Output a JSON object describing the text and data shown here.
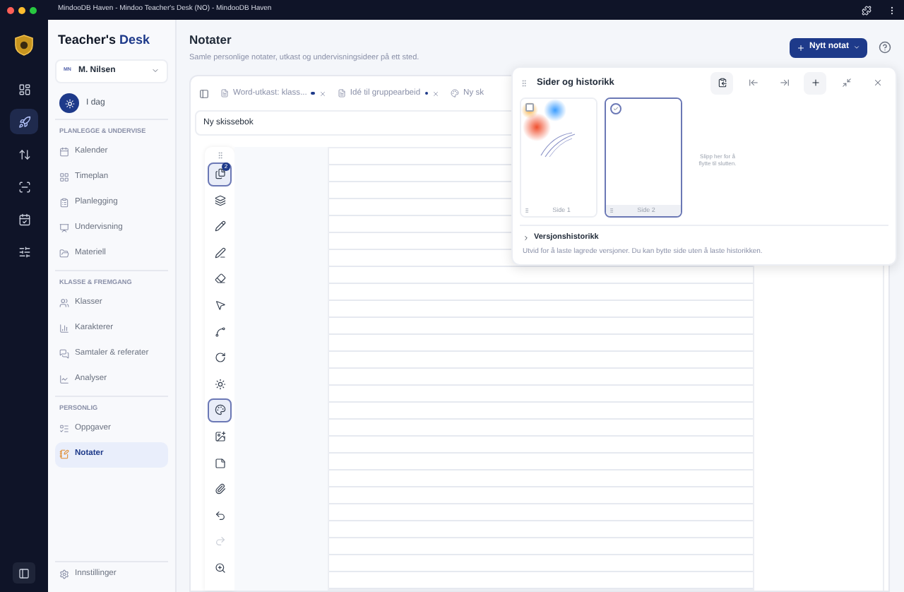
{
  "window": {
    "title": "MindooDB Haven - Mindoo Teacher's Desk (NO) - MindooDB Haven"
  },
  "rail": {
    "items": [
      {
        "kind": "dashboard",
        "selected": false
      },
      {
        "kind": "rocket",
        "selected": true
      },
      {
        "kind": "sort",
        "selected": false
      },
      {
        "kind": "scan",
        "selected": false
      },
      {
        "kind": "calendar",
        "selected": false
      },
      {
        "kind": "sliders",
        "selected": false
      }
    ]
  },
  "sidebar": {
    "brand": {
      "first": "Teacher's",
      "second": "Desk"
    },
    "user": {
      "initials": "MN",
      "name": "M. Nilsen"
    },
    "today": {
      "label": "I dag"
    },
    "sections": [
      {
        "heading": "PLANLEGGE & UNDERVISE",
        "items": [
          {
            "kind": "calendar",
            "label": "Kalender",
            "selected": false
          },
          {
            "kind": "grid",
            "label": "Timeplan",
            "selected": false
          },
          {
            "kind": "clipboard",
            "label": "Planlegging",
            "selected": false
          },
          {
            "kind": "presentation",
            "label": "Undervisning",
            "selected": false
          },
          {
            "kind": "folder",
            "label": "Materiell",
            "selected": false
          }
        ]
      },
      {
        "heading": "KLASSE & FREMGANG",
        "items": [
          {
            "kind": "users",
            "label": "Klasser",
            "selected": false
          },
          {
            "kind": "bars",
            "label": "Karakterer",
            "selected": false
          },
          {
            "kind": "chat",
            "label": "Samtaler & referater",
            "selected": false
          },
          {
            "kind": "chart",
            "label": "Analyser",
            "selected": false
          }
        ]
      },
      {
        "heading": "PERSONLIG",
        "items": [
          {
            "kind": "tasks",
            "label": "Oppgaver",
            "selected": false
          },
          {
            "kind": "notes",
            "label": "Notater",
            "selected": true
          }
        ]
      }
    ],
    "settings": "Innstillinger"
  },
  "header": {
    "title": "Notater",
    "subtitle": "Samle personlige notater, utkast og undervisningsideer på ett sted.",
    "new_button": "Nytt notat"
  },
  "tabs": [
    {
      "kind": "doc",
      "label": "Word-utkast: klass...",
      "unsaved": true
    },
    {
      "kind": "doc",
      "label": "Idé til gruppearbeid",
      "unsaved": true
    },
    {
      "kind": "sketch",
      "label": "Ny sk",
      "unsaved": false
    }
  ],
  "title_field": {
    "value": "Ny skissebok"
  },
  "tools": [
    {
      "kind": "pages",
      "selected": true,
      "disabled": false,
      "badge": "2"
    },
    {
      "kind": "layers",
      "selected": false,
      "disabled": false
    },
    {
      "kind": "pencil",
      "selected": false,
      "disabled": false
    },
    {
      "kind": "pen",
      "selected": false,
      "disabled": false
    },
    {
      "kind": "eraser",
      "selected": false,
      "disabled": false
    },
    {
      "kind": "select",
      "selected": false,
      "disabled": false
    },
    {
      "kind": "curve",
      "selected": false,
      "disabled": false
    },
    {
      "kind": "rotate",
      "selected": false,
      "disabled": false
    },
    {
      "kind": "sun",
      "selected": false,
      "disabled": false
    },
    {
      "kind": "palette",
      "selected": true,
      "disabled": false
    },
    {
      "kind": "image",
      "selected": false,
      "disabled": false
    },
    {
      "kind": "page",
      "selected": false,
      "disabled": false
    },
    {
      "kind": "attach",
      "selected": false,
      "disabled": false
    },
    {
      "kind": "undo",
      "selected": false,
      "disabled": false
    },
    {
      "kind": "redo",
      "selected": false,
      "disabled": true
    },
    {
      "kind": "zoom",
      "selected": false,
      "disabled": false
    }
  ],
  "panel": {
    "title": "Sider og historikk",
    "actions": [
      {
        "kind": "clipboard",
        "highlighted": true
      },
      {
        "kind": "move-left",
        "highlighted": false
      },
      {
        "kind": "move-right",
        "highlighted": false
      },
      {
        "kind": "add",
        "highlighted": true
      },
      {
        "kind": "shrink",
        "highlighted": false
      },
      {
        "kind": "close",
        "highlighted": false
      }
    ],
    "pages": [
      {
        "label": "Side 1",
        "selected": false,
        "kind": "sketch"
      },
      {
        "label": "Side 2",
        "selected": true,
        "kind": "blank"
      }
    ],
    "drop_hint": "Slipp her for å flytte til slutten.",
    "history": {
      "title": "Versjonshistorikk",
      "expanded": false,
      "hint": "Utvid for å laste lagrede versjoner. Du kan bytte side uten å laste historikken."
    }
  }
}
